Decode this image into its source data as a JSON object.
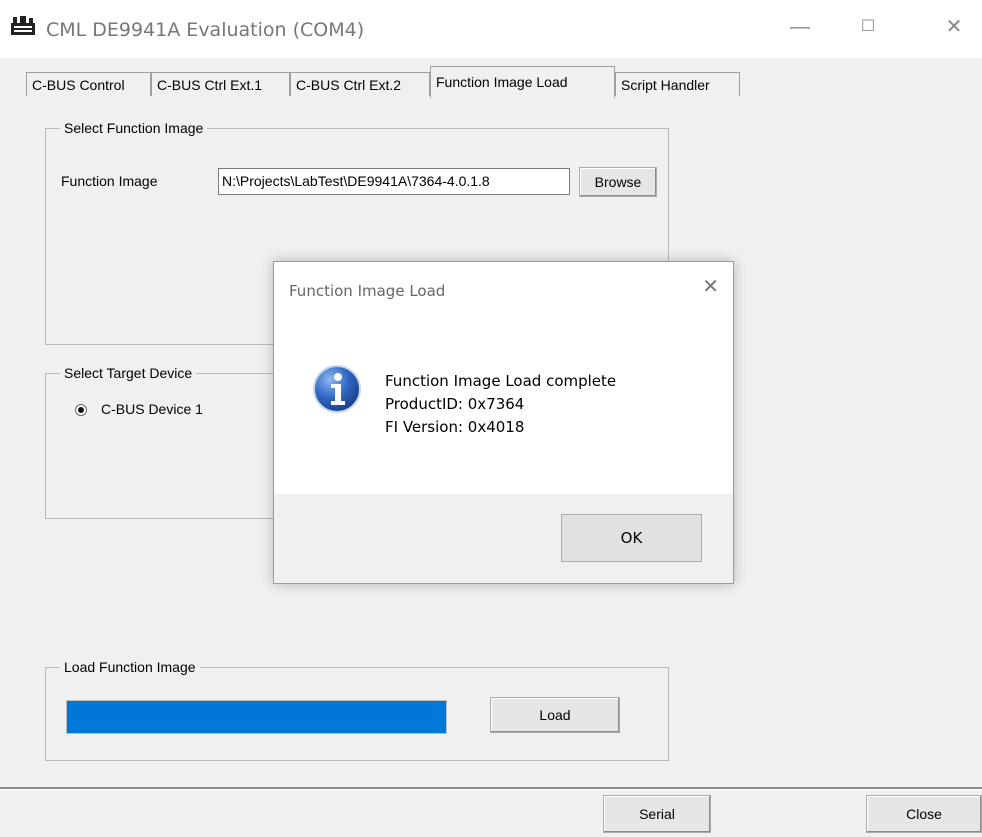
{
  "window": {
    "title": "CML DE9941A Evaluation (COM4)",
    "minimize_glyph": "—",
    "maximize_glyph": "☐",
    "close_glyph": "✕"
  },
  "tabs": [
    {
      "label": "C-BUS Control"
    },
    {
      "label": "C-BUS Ctrl Ext.1"
    },
    {
      "label": "C-BUS Ctrl Ext.2"
    },
    {
      "label": "Function Image Load",
      "active": true
    },
    {
      "label": "Script Handler"
    }
  ],
  "select_function_image": {
    "group_label": "Select Function Image",
    "field_label": "Function Image",
    "path_value": "N:\\Projects\\LabTest\\DE9941A\\7364-4.0.1.8",
    "browse_label": "Browse"
  },
  "select_target_device": {
    "group_label": "Select Target Device",
    "device_option": "C-BUS Device 1"
  },
  "load_function_image": {
    "group_label": "Load Function Image",
    "progress_percent": 100,
    "load_label": "Load"
  },
  "footer": {
    "serial_label": "Serial",
    "close_label": "Close"
  },
  "dialog": {
    "title": "Function Image Load",
    "close_glyph": "✕",
    "message_line1": "Function Image Load complete",
    "message_line2": "ProductID: 0x7364",
    "message_line3": "FI Version: 0x4018",
    "ok_label": "OK",
    "icon": "info-icon"
  },
  "colors": {
    "progress_fill": "#0078d7",
    "info_icon_blue": "#2a5fb0"
  }
}
